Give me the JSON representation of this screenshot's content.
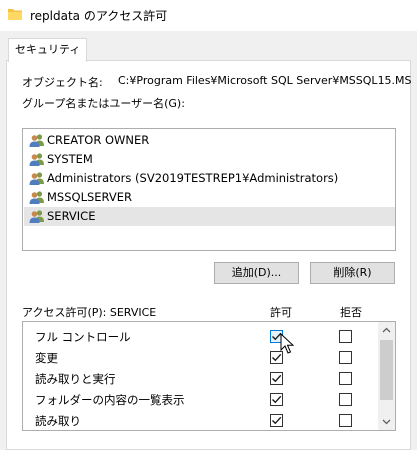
{
  "window": {
    "title": "repldata のアクセス許可",
    "folder_icon": "folder-icon"
  },
  "tabs": [
    {
      "label": "セキュリティ",
      "active": true
    }
  ],
  "object": {
    "label": "オブジェクト名:",
    "value": "C:¥Program Files¥Microsoft SQL Server¥MSSQL15.MS"
  },
  "groups": {
    "label": "グループ名またはユーザー名(G):",
    "items": [
      {
        "name": "CREATOR OWNER",
        "icon": "users-icon",
        "selected": false
      },
      {
        "name": "SYSTEM",
        "icon": "users-icon",
        "selected": false
      },
      {
        "name": "Administrators (SV2019TESTREP1¥Administrators)",
        "icon": "users-icon",
        "selected": false
      },
      {
        "name": "MSSQLSERVER",
        "icon": "users-icon",
        "selected": false
      },
      {
        "name": "SERVICE",
        "icon": "users-icon",
        "selected": true
      }
    ]
  },
  "buttons": {
    "add": "追加(D)...",
    "remove": "削除(R)"
  },
  "permissions": {
    "label": "アクセス許可(P): SERVICE",
    "allow_header": "許可",
    "deny_header": "拒否",
    "rows": [
      {
        "name": "フル コントロール",
        "allow": true,
        "deny": false,
        "focused": true
      },
      {
        "name": "変更",
        "allow": true,
        "deny": false,
        "focused": false
      },
      {
        "name": "読み取りと実行",
        "allow": true,
        "deny": false,
        "focused": false
      },
      {
        "name": "フォルダーの内容の一覧表示",
        "allow": true,
        "deny": false,
        "focused": false
      },
      {
        "name": "読み取り",
        "allow": true,
        "deny": false,
        "focused": false
      }
    ]
  },
  "colors": {
    "focus_accent": "#0078d7",
    "selection": "#e5e5e5"
  }
}
